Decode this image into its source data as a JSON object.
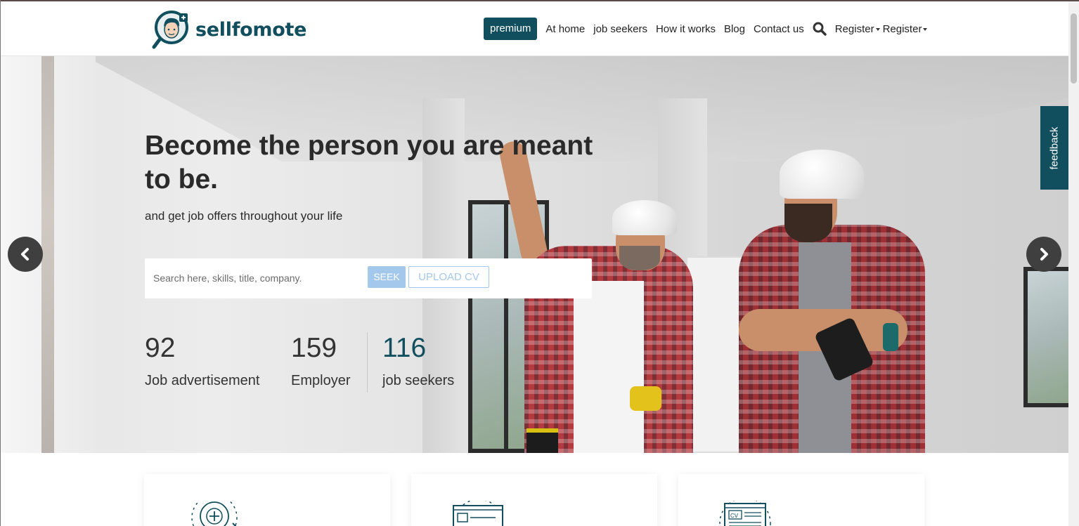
{
  "header": {
    "logo_text": "sellfomote",
    "nav": {
      "premium": "premium",
      "items": [
        "At home",
        "job seekers",
        "How it works",
        "Blog",
        "Contact us"
      ],
      "register_1": "Register",
      "register_2": "Register"
    }
  },
  "hero": {
    "title": "Become the person you are meant to be.",
    "subtitle": "and get job offers throughout your life",
    "search": {
      "placeholder": "Search here, skills, title, company.",
      "seek_label": "SEEK",
      "upload_label": "UPLOAD CV"
    },
    "stats": [
      {
        "number": "92",
        "label": "Job advertisement"
      },
      {
        "number": "159",
        "label": "Employer"
      },
      {
        "number": "116",
        "label": "job seekers"
      }
    ]
  },
  "feedback_label": "feedback",
  "icons": {
    "search": "search-icon",
    "prev": "chevron-left-icon",
    "next": "chevron-right-icon",
    "card_1": "add-job-icon",
    "card_2": "browser-window-icon",
    "card_3": "cv-document-icon"
  },
  "colors": {
    "brand": "#124f5e",
    "seek_button": "#a3c8ec",
    "arrow_button": "#3f3f3f"
  }
}
